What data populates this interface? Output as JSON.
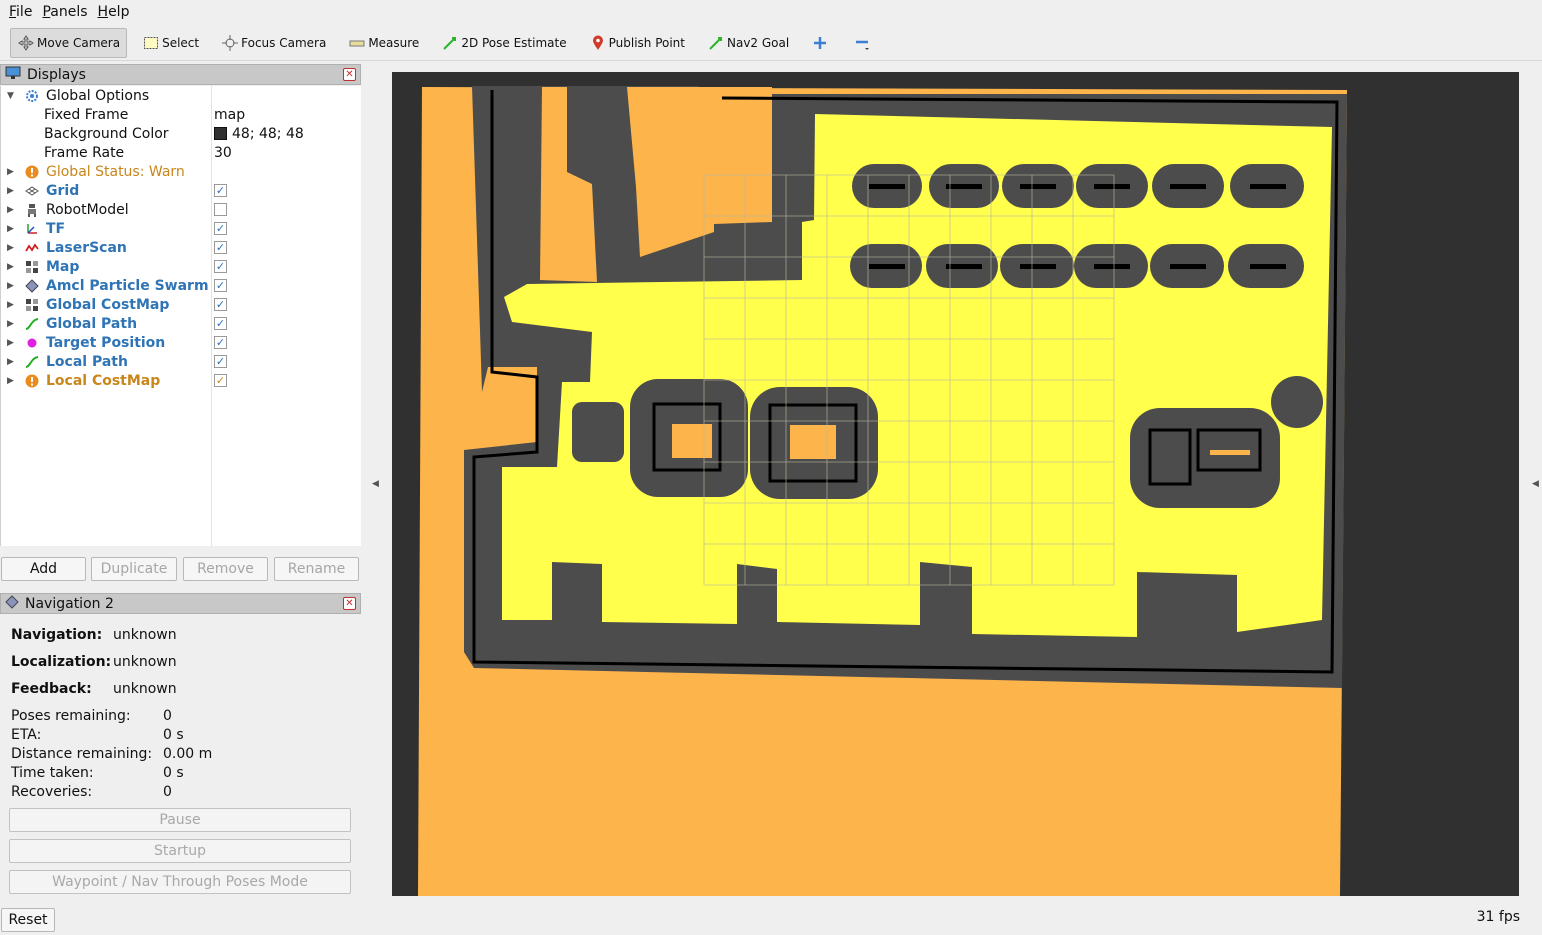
{
  "menu": [
    "File",
    "Panels",
    "Help"
  ],
  "toolbar": [
    {
      "label": "Move Camera",
      "icon": "move-camera-icon",
      "active": true
    },
    {
      "label": "Select",
      "icon": "select-icon"
    },
    {
      "label": "Focus Camera",
      "icon": "focus-camera-icon"
    },
    {
      "label": "Measure",
      "icon": "measure-icon"
    },
    {
      "label": "2D Pose Estimate",
      "icon": "pose-estimate-icon"
    },
    {
      "label": "Publish Point",
      "icon": "publish-point-icon"
    },
    {
      "label": "Nav2 Goal",
      "icon": "nav2-goal-icon"
    }
  ],
  "displays": {
    "title": "Displays",
    "global_options": "Global Options",
    "fixed_frame_label": "Fixed Frame",
    "fixed_frame_value": "map",
    "bg_color_label": "Background Color",
    "bg_color_value": "48; 48; 48",
    "frame_rate_label": "Frame Rate",
    "frame_rate_value": "30",
    "global_status": "Global Status: Warn",
    "items": [
      {
        "label": "Grid",
        "checked": true
      },
      {
        "label": "RobotModel",
        "checked": false
      },
      {
        "label": "TF",
        "checked": true
      },
      {
        "label": "LaserScan",
        "checked": true
      },
      {
        "label": "Map",
        "checked": true
      },
      {
        "label": "Amcl Particle Swarm",
        "checked": true
      },
      {
        "label": "Global CostMap",
        "checked": true
      },
      {
        "label": "Global Path",
        "checked": true
      },
      {
        "label": "Target Position",
        "checked": true
      },
      {
        "label": "Local Path",
        "checked": true
      },
      {
        "label": "Local CostMap",
        "checked": true
      }
    ]
  },
  "buttons": {
    "add": "Add",
    "duplicate": "Duplicate",
    "remove": "Remove",
    "rename": "Rename"
  },
  "nav2": {
    "title": "Navigation 2",
    "navigation_label": "Navigation:",
    "navigation_value": "unknown",
    "localization_label": "Localization:",
    "localization_value": "unknown",
    "feedback_label": "Feedback:",
    "feedback_value": "unknown",
    "poses_label": "Poses remaining:",
    "poses_value": "0",
    "eta_label": "ETA:",
    "eta_value": "0 s",
    "distance_label": "Distance remaining:",
    "distance_value": "0.00 m",
    "time_label": "Time taken:",
    "time_value": "0 s",
    "recoveries_label": "Recoveries:",
    "recoveries_value": "0",
    "pause": "Pause",
    "startup": "Startup",
    "waypoint": "Waypoint / Nav Through Poses Mode"
  },
  "bottom": {
    "reset": "Reset",
    "fps": "31 fps"
  },
  "colors": {
    "background": "#303030",
    "unknown": "#fdb44b",
    "free": "#ffff4c",
    "inflation": "#4c4c4c",
    "wall": "#000000"
  }
}
